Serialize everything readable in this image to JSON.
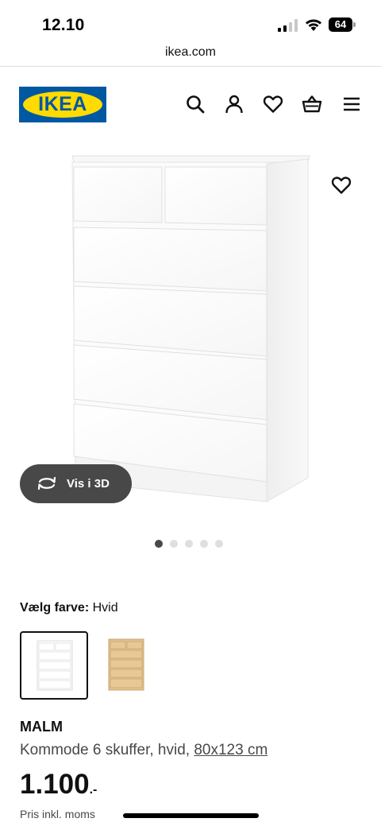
{
  "status_bar": {
    "time": "12.10",
    "battery": "64"
  },
  "browser": {
    "url": "ikea.com"
  },
  "header": {
    "logo_text": "IKEA",
    "icons": [
      "search-icon",
      "account-icon",
      "favorites-icon",
      "cart-icon",
      "menu-icon"
    ]
  },
  "gallery": {
    "view_3d_label": "Vis i 3D",
    "image_count": 5,
    "active_index": 0
  },
  "color_select": {
    "label": "Vælg farve:",
    "value": "Hvid",
    "options": [
      "Hvid",
      "Hvidpigmenteret egetræsmønstret"
    ],
    "selected_index": 0
  },
  "product": {
    "name": "MALM",
    "description": "Kommode 6 skuffer, hvid,",
    "size": "80x123 cm",
    "price": "1.100",
    "price_suffix": ".-",
    "price_note": "Pris inkl. moms"
  },
  "colors": {
    "ikea_blue": "#0058a3",
    "ikea_yellow": "#ffdb00",
    "pill_bg": "#484848",
    "oak": "#e3c28f"
  }
}
